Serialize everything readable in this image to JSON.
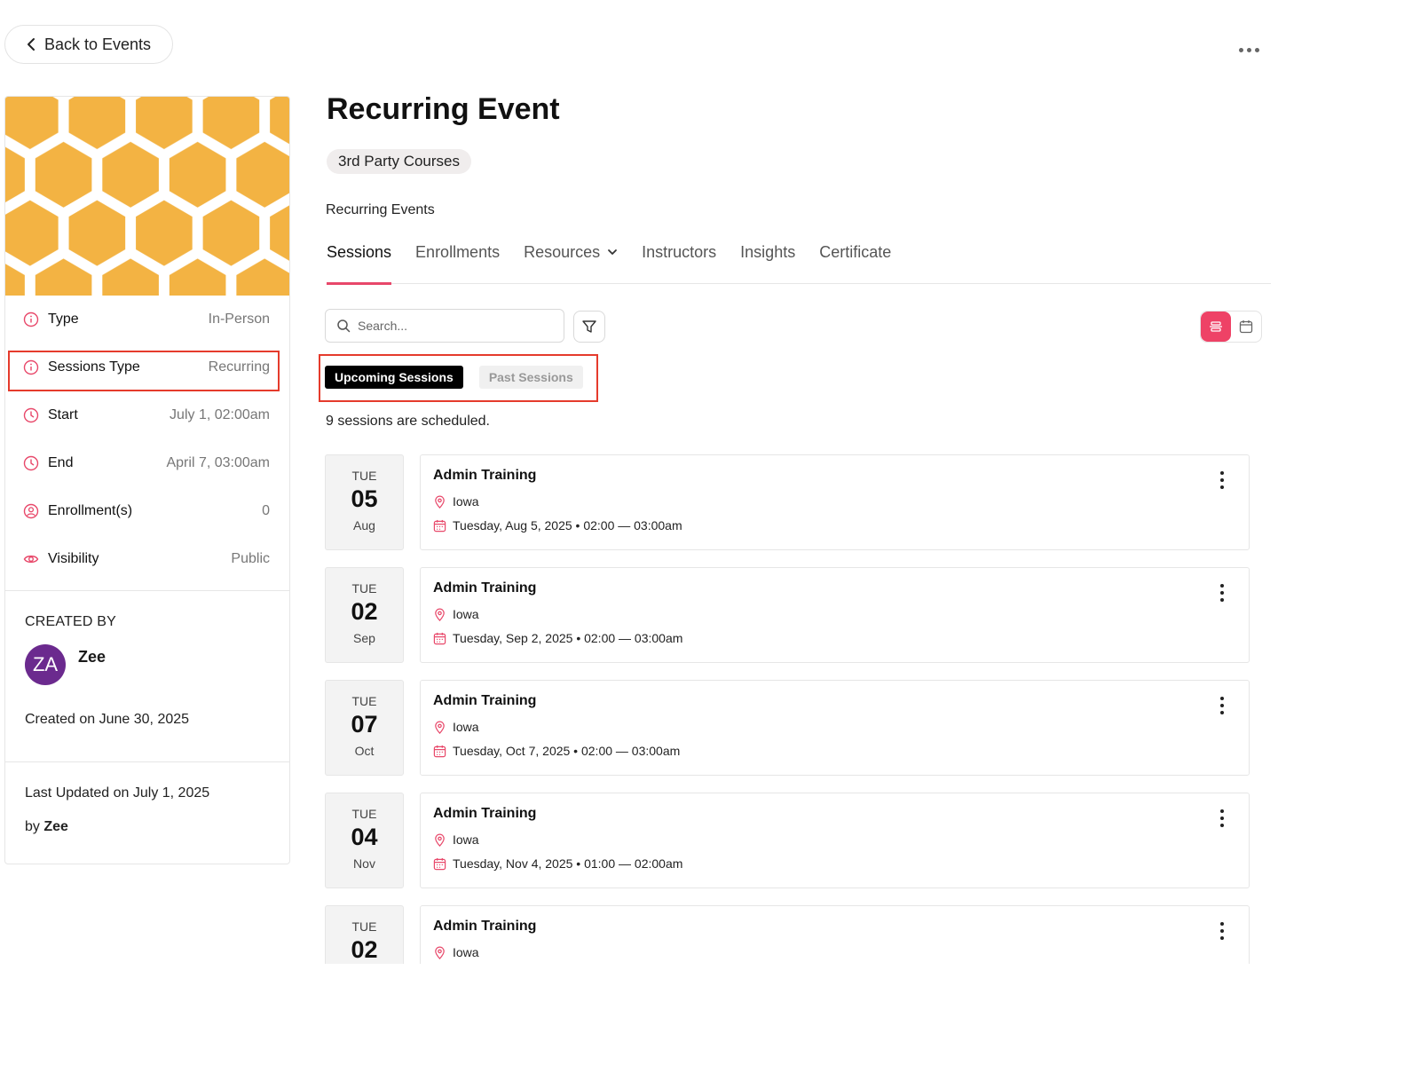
{
  "nav": {
    "back_label": "Back to Events"
  },
  "event": {
    "title": "Recurring Event",
    "category_badge": "3rd Party Courses",
    "breadcrumb": "Recurring Events"
  },
  "details": {
    "rows": [
      {
        "label": "Type",
        "value": "In-Person",
        "icon": "info-icon"
      },
      {
        "label": "Sessions Type",
        "value": "Recurring",
        "icon": "info-icon"
      },
      {
        "label": "Start",
        "value": "July 1, 02:00am",
        "icon": "clock-icon"
      },
      {
        "label": "End",
        "value": "April 7, 03:00am",
        "icon": "clock-icon"
      },
      {
        "label": "Enrollment(s)",
        "value": "0",
        "icon": "user-icon"
      },
      {
        "label": "Visibility",
        "value": "Public",
        "icon": "eye-icon"
      }
    ]
  },
  "creator": {
    "heading": "CREATED BY",
    "initials": "ZA",
    "name": "Zee",
    "created_on": "Created on June 30, 2025",
    "last_updated": "Last Updated on July 1, 2025",
    "by_prefix": "by",
    "by_name": "Zee"
  },
  "tabs": [
    {
      "label": "Sessions",
      "active": true
    },
    {
      "label": "Enrollments"
    },
    {
      "label": "Resources",
      "dropdown": true
    },
    {
      "label": "Instructors"
    },
    {
      "label": "Insights"
    },
    {
      "label": "Certificate"
    }
  ],
  "search": {
    "placeholder": "Search..."
  },
  "segments": {
    "upcoming": "Upcoming Sessions",
    "past": "Past Sessions"
  },
  "sessions_count_text": "9 sessions are scheduled.",
  "sessions": [
    {
      "dow": "TUE",
      "day": "05",
      "month": "Aug",
      "title": "Admin Training",
      "location": "Iowa",
      "when": "Tuesday, Aug 5, 2025 • 02:00 — 03:00am"
    },
    {
      "dow": "TUE",
      "day": "02",
      "month": "Sep",
      "title": "Admin Training",
      "location": "Iowa",
      "when": "Tuesday, Sep 2, 2025 • 02:00 — 03:00am"
    },
    {
      "dow": "TUE",
      "day": "07",
      "month": "Oct",
      "title": "Admin Training",
      "location": "Iowa",
      "when": "Tuesday, Oct 7, 2025 • 02:00 — 03:00am"
    },
    {
      "dow": "TUE",
      "day": "04",
      "month": "Nov",
      "title": "Admin Training",
      "location": "Iowa",
      "when": "Tuesday, Nov 4, 2025 • 01:00 — 02:00am"
    },
    {
      "dow": "TUE",
      "day": "02",
      "month": "",
      "title": "Admin Training",
      "location": "Iowa",
      "when": ""
    }
  ],
  "colors": {
    "accent": "#ee4266",
    "highlight": "#e53b2c",
    "hero": "#f3b343",
    "avatar": "#6b2a8e"
  }
}
